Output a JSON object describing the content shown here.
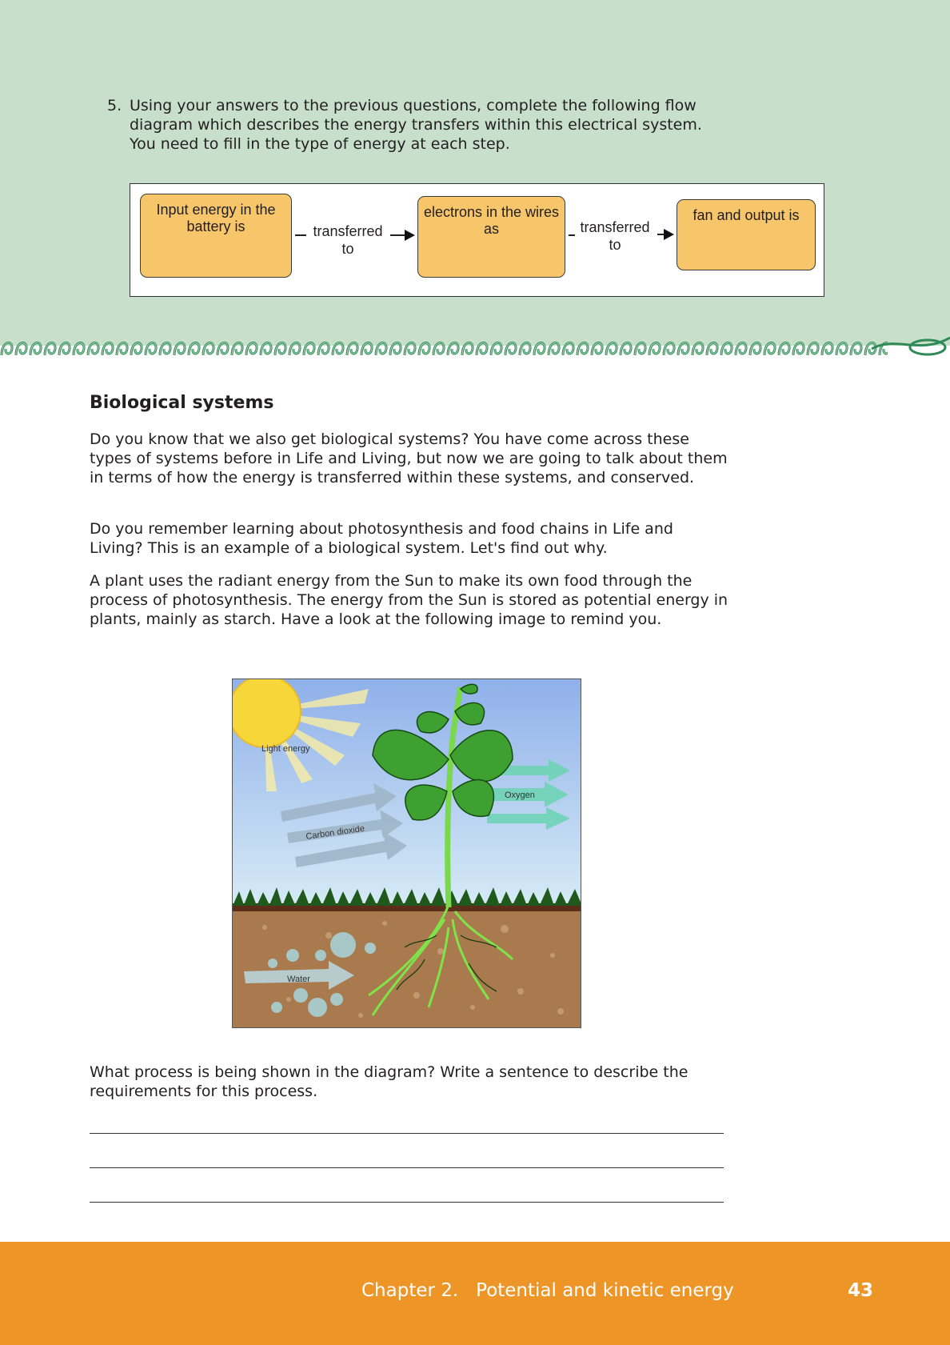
{
  "question": {
    "number": "5.",
    "text": "Using your answers to the previous questions, complete the following flow diagram which describes the energy transfers within this electrical system. You need to fill in the type of energy at each step."
  },
  "flow_diagram": {
    "boxes": [
      "Input energy in the battery is",
      "electrons in the wires as",
      "fan and output is"
    ],
    "connectors": [
      "transferred to",
      "transferred to"
    ]
  },
  "section": {
    "title": "Biological systems",
    "paragraphs": [
      "Do you know that we also get biological systems? You have come across these types of systems before in Life and Living, but now we are going to talk about them in terms of how the energy is transferred within these systems, and conserved.",
      "Do you remember learning about photosynthesis and food chains in Life and Living? This is an example of a biological system. Let's find out why.",
      "A plant uses the radiant energy from the Sun to make its own food through the process of photosynthesis. The energy from the Sun is stored as potential energy in plants, mainly as starch. Have a look at the following image to remind you."
    ]
  },
  "illustration": {
    "labels": {
      "light": "Light energy",
      "carbon_dioxide": "Carbon dioxide",
      "oxygen": "Oxygen",
      "water": "Water"
    }
  },
  "prompt": "What process is being shown in the diagram? Write a sentence to describe the requirements for this process.",
  "footer": {
    "chapter": "Chapter 2.   Potential and kinetic energy",
    "page": "43"
  },
  "colors": {
    "top_band": "#c8e0cb",
    "flow_box": "#f7c56a",
    "footer": "#ee9527"
  }
}
